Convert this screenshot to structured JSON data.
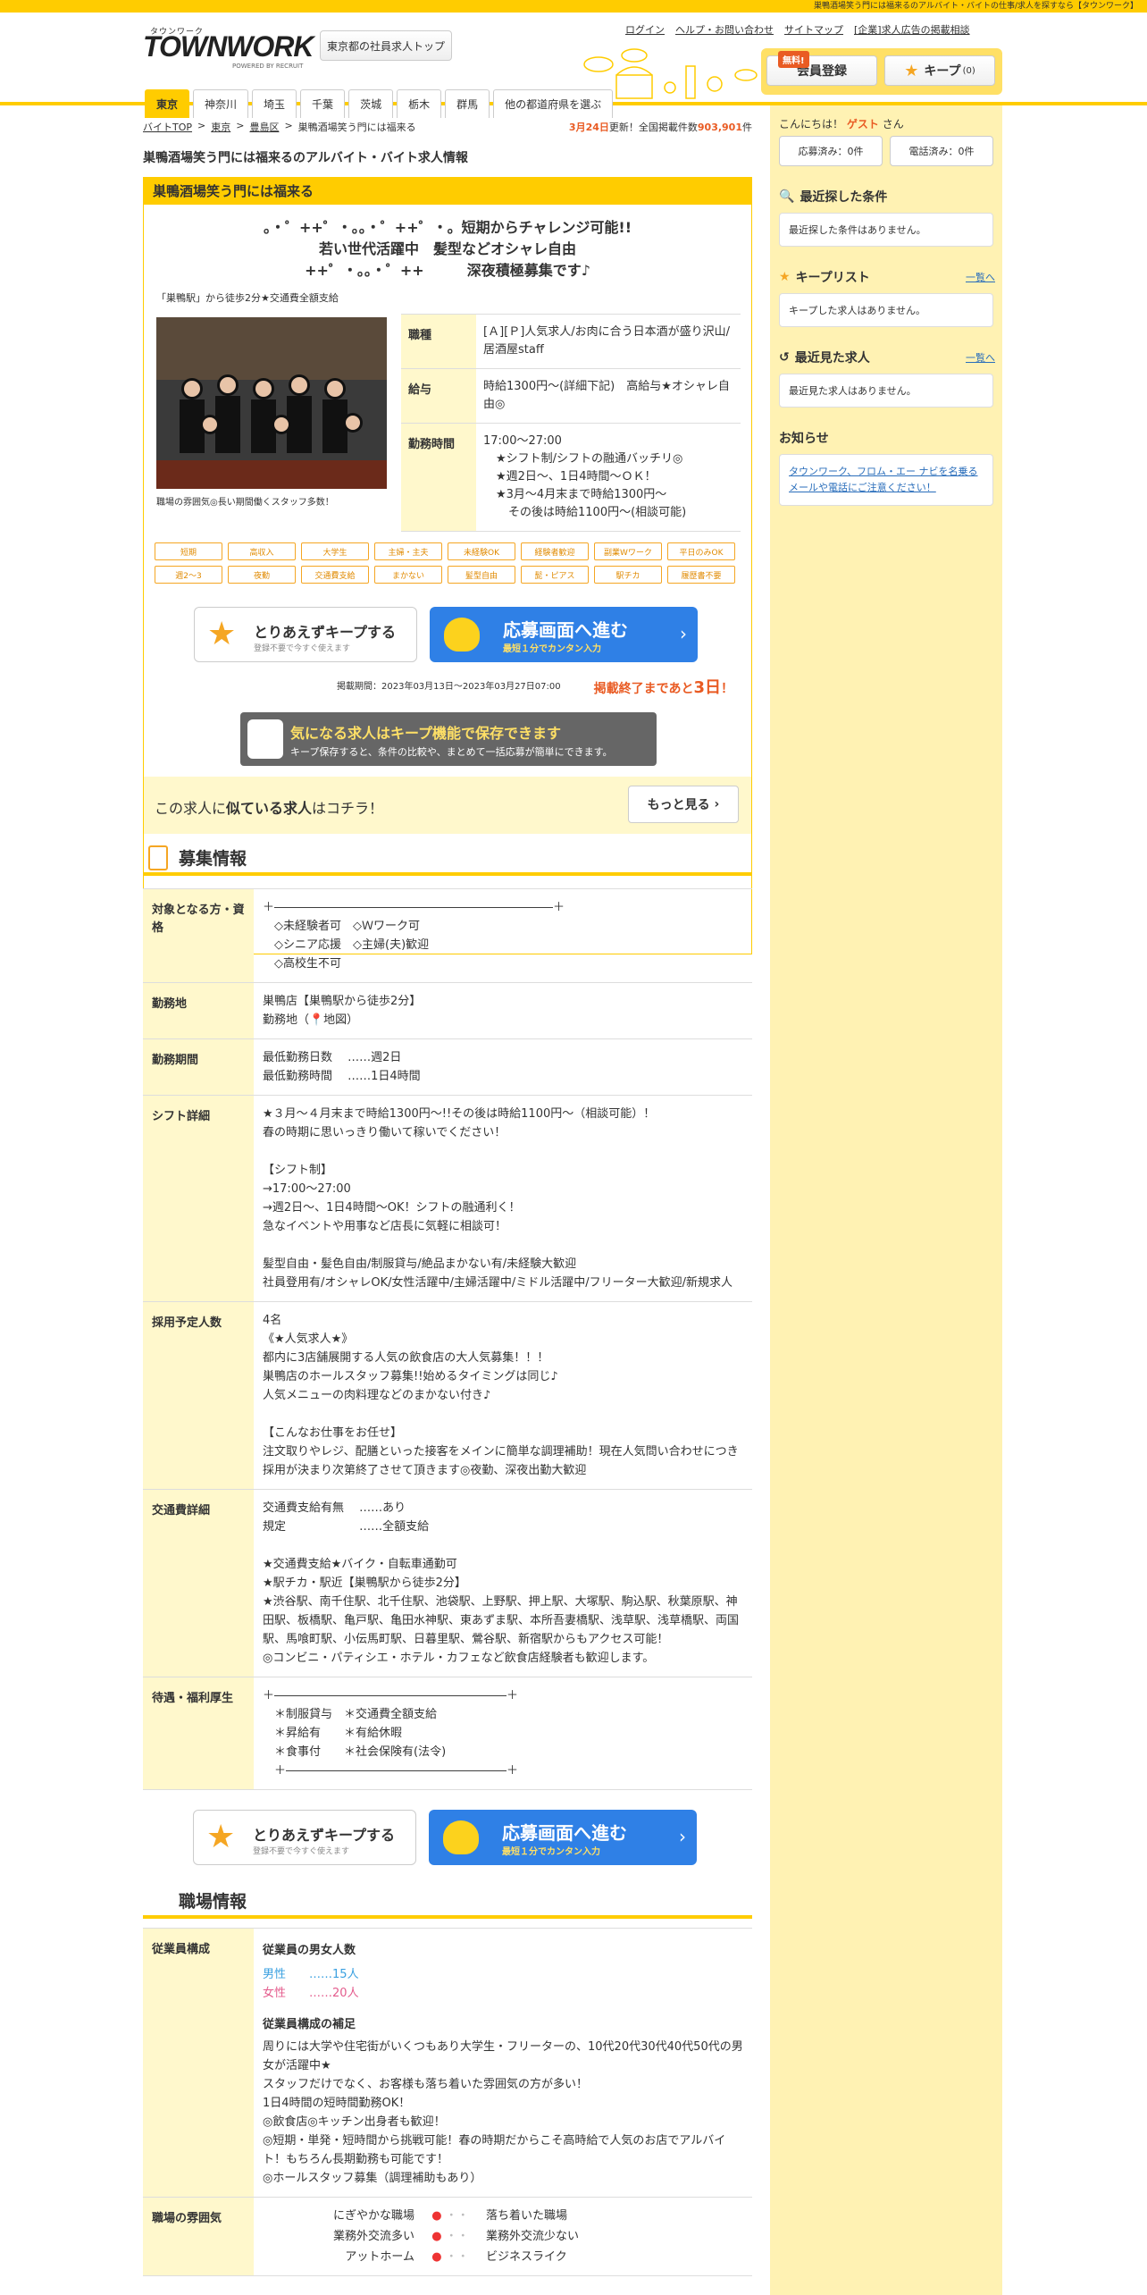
{
  "topstrip": "巣鴨酒場笑う門には福来るのアルバイト・バイトの仕事/求人を探すなら【タウンワーク】",
  "logo": {
    "kana": "タウンワーク",
    "main": "TOWNWORK",
    "sub": "POWERED BY RECRUIT"
  },
  "header": {
    "pref_top": "東京都の社員求人トップ",
    "links": [
      "ログイン",
      "ヘルプ・お問い合わせ",
      "サイトマップ",
      "[企業]求人広告の掲載相談"
    ],
    "free_badge": "無料!",
    "member": "会員登録",
    "keep": "キープ",
    "keep_count": "(0)"
  },
  "nav": [
    "東京",
    "神奈川",
    "埼玉",
    "千葉",
    "茨城",
    "栃木",
    "群馬",
    "他の都道府県を選ぶ"
  ],
  "breadcrumb": [
    "バイトTOP",
    "東京",
    "豊島区",
    "巣鴨酒場笑う門には福来る"
  ],
  "update": {
    "date": "3月24日",
    "text1": "更新！全国掲載件数",
    "count": "903,901",
    "unit": "件"
  },
  "page_title": "巣鴨酒場笑う門には福来るのアルバイト・バイト求人情報",
  "job": {
    "name": "巣鴨酒場笑う門には福来る",
    "catch1": "。・゜++゜・。。・゜++゜・。短期からチャレンジ可能!!",
    "catch2": "若い世代活躍中　髪型などオシャレ自由",
    "catch3": "++゜・。。・゜++　　　深夜積極募集です♪",
    "access": "「巣鴨駅」から徒歩2分★交通費全額支給",
    "photo_caption": "職場の雰囲気◎長い期間働くスタッフ多数！",
    "info": {
      "type_h": "職種",
      "type": "[Ａ][Ｐ]人気求人/お肉に合う日本酒が盛り沢山/居酒屋staff",
      "pay_h": "給与",
      "pay": "時給1300円～(詳細下記)　高給与★オシャレ自由◎",
      "time_h": "勤務時間",
      "time1": "17:00～27:00",
      "time2": "★シフト制/シフトの融通バッチリ◎",
      "time3": "★週2日～、1日4時間～ＯＫ！",
      "time4": "★3月～4月末まで時給1300円～",
      "time5": "その後は時給1100円～(相談可能)"
    },
    "tags": [
      "短期",
      "高収入",
      "大学生",
      "主婦・主夫",
      "未経験OK",
      "経験者歓迎",
      "副業Wワーク",
      "平日のみOK",
      "週2～3",
      "夜勤",
      "交通費支給",
      "まかない",
      "髪型自由",
      "髭・ピアス",
      "駅チカ",
      "履歴書不要"
    ],
    "keep_cta": "とりあえずキープする",
    "keep_cta_sub": "登録不要で今すぐ使えます",
    "apply_cta": "応募画面へ進む",
    "apply_cta_sub": "最短１分でカンタン入力",
    "period": "掲載期間：2023年03月13日～2023年03月27日07:00",
    "remain_pre": "掲載終了まであと",
    "remain_days": "3日",
    "remain_post": "！",
    "keep_banner": "気になる求人はキープ機能で保存できます",
    "keep_banner_sub": "キープ保存すると、条件の比較や、まとめて一括応募が簡単にできます。",
    "similar_pre": "この求人に",
    "similar_bold": "似ている求人",
    "similar_post": "はコチラ！",
    "more": "もっと見る"
  },
  "recruit": {
    "title": "募集情報",
    "rows": [
      {
        "h": "対象となる方・資格",
        "v": "＋――――――――――――――――――――――――＋\n　◇未経験者可　◇Ｗワーク可\n　◇シニア応援　◇主婦(夫)歓迎\n　◇高校生不可"
      },
      {
        "h": "勤務地",
        "v": "巣鴨店【巣鴨駅から徒歩2分】\n勤務地（📍地図）"
      },
      {
        "h": "勤務期間",
        "v": "最低勤務日数　 ……週2日\n最低勤務時間　 ……1日4時間"
      },
      {
        "h": "シフト詳細",
        "v": "★３月～４月末まで時給1300円～!!その後は時給1100円～（相談可能）！\n春の時期に思いっきり働いて稼いでください！\n\n【シフト制】\n→17:00～27:00\n→週2日～、1日4時間～OK！シフトの融通利く！\n急なイベントや用事など店長に気軽に相談可！\n\n髪型自由・髪色自由/制服貸与/絶品まかない有/未経験大歓迎\n社員登用有/オシャレOK/女性活躍中/主婦活躍中/ミドル活躍中/フリーター大歓迎/新規求人"
      },
      {
        "h": "採用予定人数",
        "v": "4名\n《★人気求人★》\n都内に3店舗展開する人気の飲食店の大人気募集！！！\n巣鴨店のホールスタッフ募集!!始めるタイミングは同じ♪\n人気メニューの肉料理などのまかない付き♪\n\n【こんなお仕事をお任せ】\n注文取りやレジ、配膳といった接客をメインに簡単な調理補助！現在人気問い合わせにつき採用が決まり次第終了させて頂きます◎夜勤、深夜出勤大歓迎"
      },
      {
        "h": "交通費詳細",
        "v": "交通費支給有無　 ……あり\n規定　　　　　　 ……全額支給\n\n★交通費支給★バイク・自転車通勤可\n★駅チカ・駅近【巣鴨駅から徒歩2分】\n★渋谷駅、南千住駅、北千住駅、池袋駅、上野駅、押上駅、大塚駅、駒込駅、秋葉原駅、神田駅、板橋駅、亀戸駅、亀田水神駅、東あずま駅、本所吾妻橋駅、浅草駅、浅草橋駅、両国駅、馬喰町駅、小伝馬町駅、日暮里駅、鶯谷駅、新宿駅からもアクセス可能！\n◎コンビニ・パティシエ・ホテル・カフェなど飲食店経験者も歓迎します。"
      },
      {
        "h": "待遇・福利厚生",
        "v": "＋――――――――――――――――――――＋\n　＊制服貸与　＊交通費全額支給\n　＊昇給有　　＊有給休暇\n　＊食事付　　＊社会保険有(法令)\n　＋―――――――――――――――――――＋"
      }
    ]
  },
  "workplace": {
    "title": "職場情報",
    "staff_h": "従業員構成",
    "gender_title": "従業員の男女人数",
    "male_label": "男性",
    "male_value": "……15人",
    "female_label": "女性",
    "female_value": "……20人",
    "supp_title": "従業員構成の補足",
    "supp": "周りには大学や住宅街がいくつもあり大学生・フリーターの、10代20代30代40代50代の男女が活躍中★\nスタッフだけでなく、お客様も落ち着いた雰囲気の方が多い！\n1日4時間の短時間勤務OK！\n◎飲食店◎キッチン出身者も歓迎！\n◎短期・単発・短時間から挑戦可能！春の時期だからこそ高時給で人気のお店でアルバイト！もちろん長期勤務も可能です！\n◎ホールスタッフ募集（調理補助もあり）",
    "atmos_h": "職場の雰囲気",
    "atmos": [
      {
        "l": "にぎやかな職場",
        "r": "落ち着いた職場",
        "level": 0
      },
      {
        "l": "業務外交流多い",
        "r": "業務外交流少ない",
        "level": 0
      },
      {
        "l": "アットホーム",
        "r": "ビジネスライク",
        "level": 0
      }
    ]
  },
  "sidebar": {
    "greet": "こんにちは！",
    "guest": "ゲスト",
    "san": "さん",
    "applied": "応募済み：0件",
    "called": "電話済み：0件",
    "recent_cond_h": "最近探した条件",
    "recent_cond": "最近探した条件はありません。",
    "keep_list_h": "キープリスト",
    "keep_list_link": "一覧へ",
    "keep_list": "キープした求人はありません。",
    "recent_view_h": "最近見た求人",
    "recent_view_link": "一覧へ",
    "recent_view": "最近見た求人はありません。",
    "notice_h": "お知らせ",
    "notice": "タウンワーク、フロム・エー ナビを名乗るメールや電話にご注意ください！"
  },
  "colors": {
    "accent": "#ffcc00",
    "brand_orange": "#e95b23",
    "apply_blue": "#2f80e6"
  }
}
